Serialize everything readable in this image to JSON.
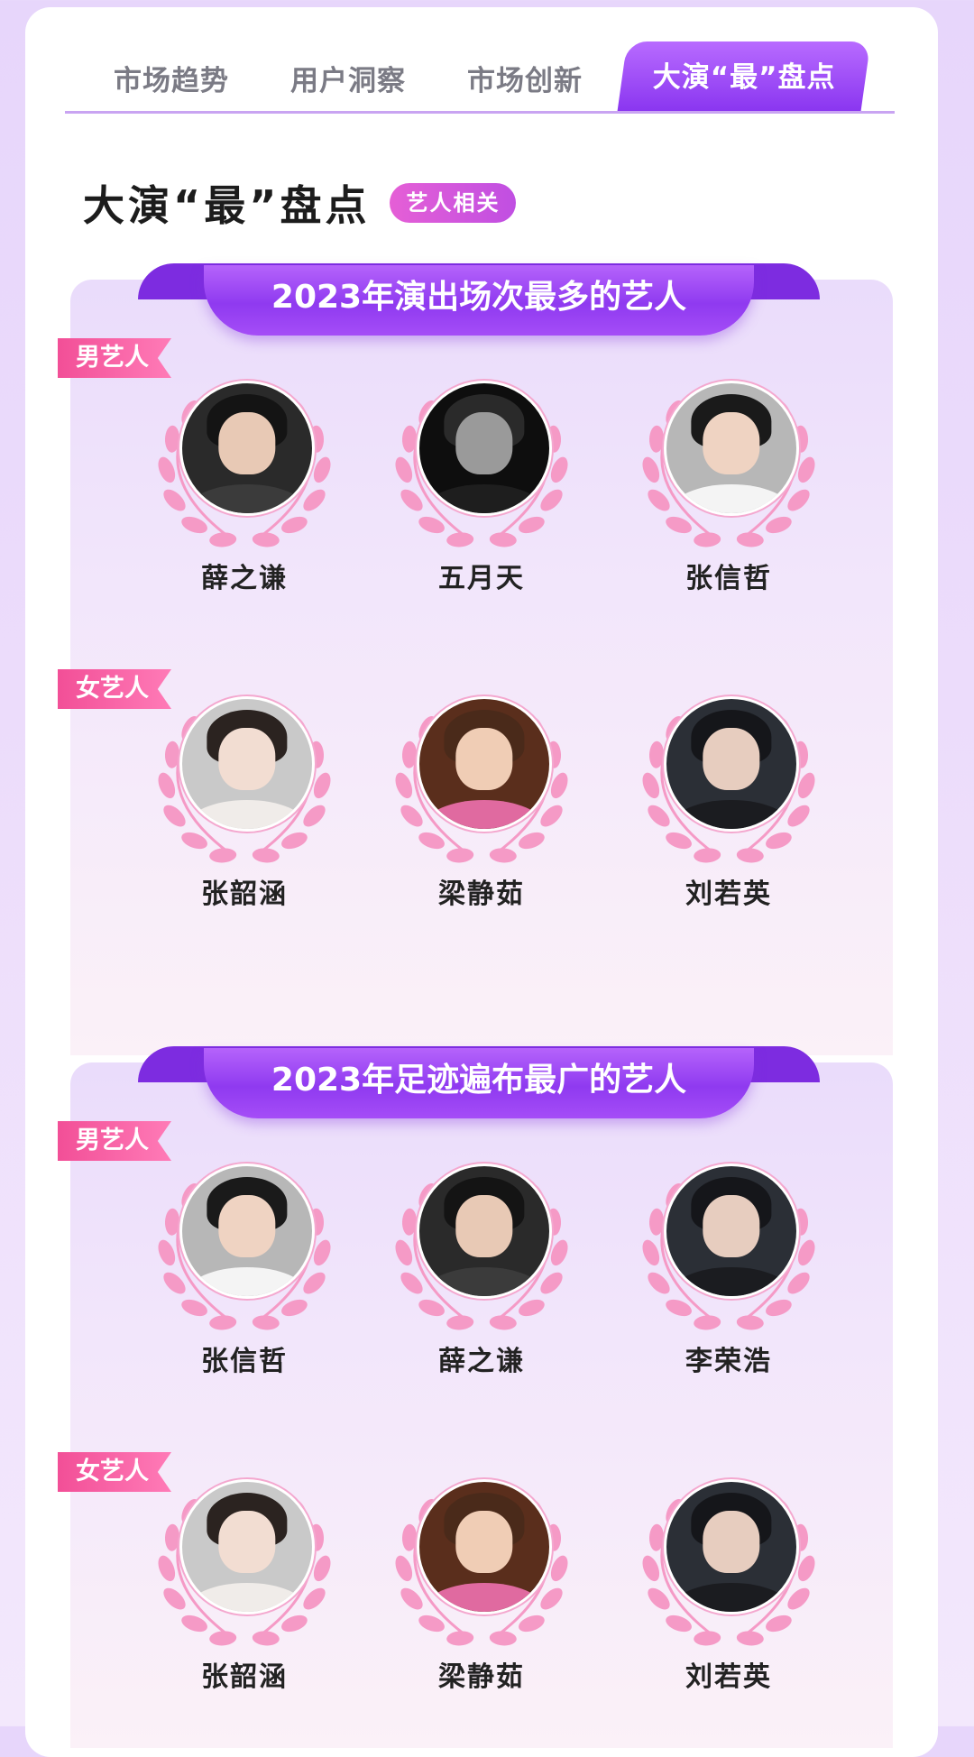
{
  "tabs": [
    {
      "label": "市场趋势",
      "active": false
    },
    {
      "label": "用户洞察",
      "active": false
    },
    {
      "label": "市场创新",
      "active": false
    },
    {
      "label": "大演“最”盘点",
      "active": true
    }
  ],
  "heading": {
    "title": "大演“最”盘点",
    "badge": "艺人相关"
  },
  "sections": [
    {
      "title": "2023年演出场次最多的艺人",
      "groups": [
        {
          "tag": "男艺人",
          "artists": [
            {
              "name": "薛之谦",
              "avatar": "person-photo"
            },
            {
              "name": "五月天",
              "avatar": "band-photo"
            },
            {
              "name": "张信哲",
              "avatar": "person-photo"
            }
          ]
        },
        {
          "tag": "女艺人",
          "artists": [
            {
              "name": "张韶涵",
              "avatar": "person-photo"
            },
            {
              "name": "梁静茹",
              "avatar": "person-photo"
            },
            {
              "name": "刘若英",
              "avatar": "person-photo"
            }
          ]
        }
      ]
    },
    {
      "title": "2023年足迹遍布最广的艺人",
      "groups": [
        {
          "tag": "男艺人",
          "artists": [
            {
              "name": "张信哲",
              "avatar": "person-photo"
            },
            {
              "name": "薛之谦",
              "avatar": "person-photo"
            },
            {
              "name": "李荣浩",
              "avatar": "person-photo"
            }
          ]
        },
        {
          "tag": "女艺人",
          "artists": [
            {
              "name": "张韶涵",
              "avatar": "person-photo"
            },
            {
              "name": "梁静茹",
              "avatar": "person-photo"
            },
            {
              "name": "刘若英",
              "avatar": "person-photo"
            }
          ]
        }
      ]
    }
  ],
  "colors": {
    "accent_purple": "#8a36f0",
    "tag_pink": "#f24f97",
    "laurel_pink": "#f59ac6"
  }
}
